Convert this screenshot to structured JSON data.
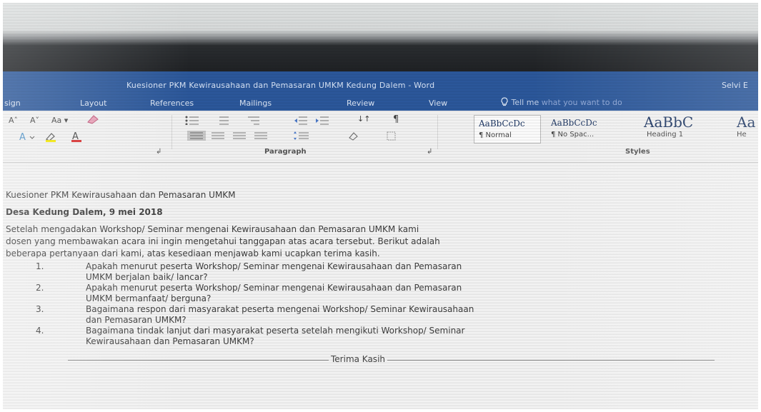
{
  "window": {
    "title": "Kuesioner PKM Kewirausahaan dan Pemasaran UMKM Kedung Dalem  -  Word",
    "user": "Selvi E"
  },
  "ribbon": {
    "tabs": [
      "sign",
      "Layout",
      "References",
      "Mailings",
      "Review",
      "View"
    ],
    "tell_me_prefix": "Tell me",
    "tell_me_placeholder": "what you want to do",
    "font_buttons": {
      "grow": "A˄",
      "shrink": "A˅",
      "case": "Aa ▾",
      "highlight": "⨾",
      "pilcrow": "¶",
      "sort": "↓↑"
    },
    "group_labels": {
      "font_launcher": "↲",
      "paragraph": "Paragraph",
      "paragraph_launcher": "↲",
      "styles": "Styles"
    },
    "styles": [
      {
        "sample": "AaBbCcDc",
        "name": "¶ Normal"
      },
      {
        "sample": "AaBbCcDc",
        "name": "¶ No Spac..."
      },
      {
        "sample": "AaBbC",
        "name": "Heading 1"
      },
      {
        "sample": "Aa",
        "name": "He"
      }
    ]
  },
  "document": {
    "title_line": "Kuesioner PKM Kewirausahaan dan Pemasaran UMKM",
    "date_line": "Desa Kedung Dalem, 9 mei 2018",
    "intro": [
      "Setelah mengadakan Workshop/ Seminar mengenai Kewirausahaan dan Pemasaran UMKM kami",
      "dosen yang membawakan acara ini ingin mengetahui tanggapan atas acara tersebut.  Berikut adalah",
      "beberapa pertanyaan dari kami, atas kesediaan menjawab kami ucapkan terima kasih."
    ],
    "questions": [
      {
        "num": "1.",
        "lines": [
          "Apakah menurut peserta Workshop/ Seminar mengenai Kewirausahaan dan Pemasaran",
          "UMKM berjalan baik/ lancar?"
        ]
      },
      {
        "num": "2.",
        "lines": [
          "Apakah menurut peserta Workshop/ Seminar mengenai Kewirausahaan dan Pemasaran",
          "UMKM bermanfaat/ berguna?"
        ]
      },
      {
        "num": "3.",
        "lines": [
          "Bagaimana respon dari masyarakat peserta mengenai Workshop/ Seminar Kewirausahaan",
          "dan Pemasaran UMKM?"
        ]
      },
      {
        "num": "4.",
        "lines": [
          "Bagaimana tindak lanjut dari masyarakat peserta setelah mengikuti Workshop/ Seminar",
          "Kewirausahaan dan Pemasaran UMKM?"
        ]
      }
    ],
    "closing": "Terima Kasih"
  },
  "colors": {
    "titlebar": "#2b579a",
    "ribbon": "#f1f1f1",
    "document": "#f2f2f2"
  }
}
